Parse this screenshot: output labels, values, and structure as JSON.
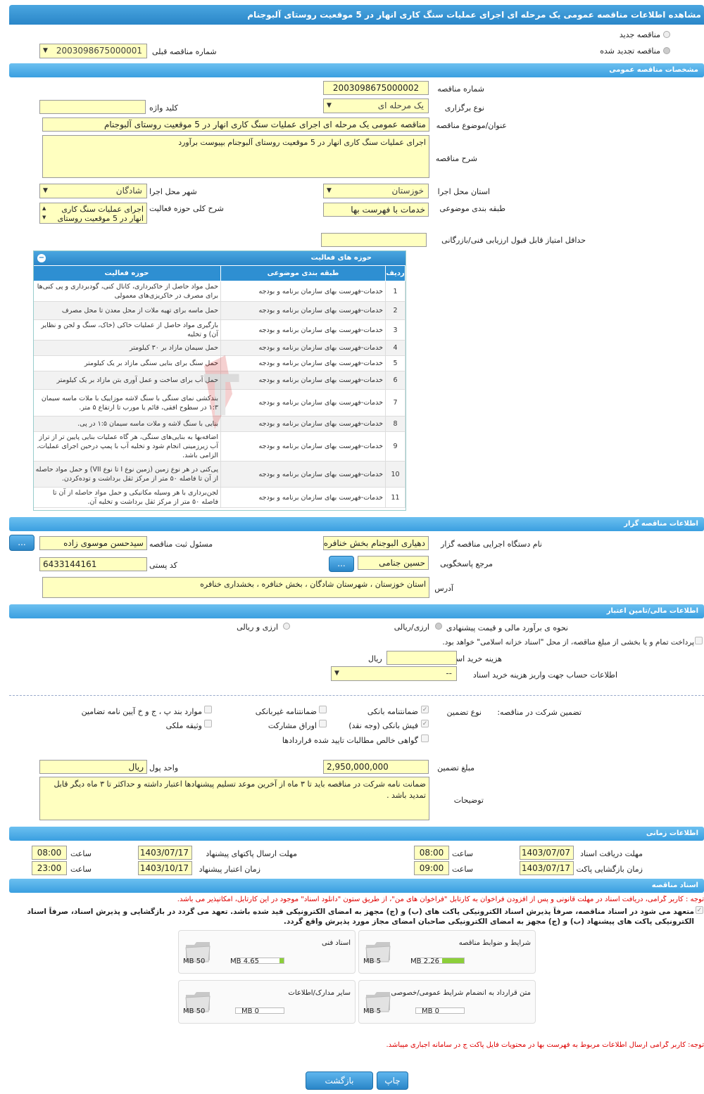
{
  "title": "مشاهده اطلاعات مناقصه عمومی یک مرحله ای اجرای عملیات سنگ کاری انهار در 5 موقعیت روستای آلبوجنام",
  "top": {
    "new_tender": "مناقصه جدید",
    "renewed_tender": "مناقصه تجدید شده",
    "prev_number_label": "شماره مناقصه قبلی",
    "prev_number": "2003098675000001"
  },
  "general": {
    "header": "مشخصات مناقصه عمومی",
    "number_label": "شماره مناقصه",
    "number": "2003098675000002",
    "type_label": "نوع برگزاری",
    "type": "یک مرحله ای",
    "keyword_label": "کلید واژه",
    "keyword": "",
    "subject_label": "عنوان/موضوع مناقصه",
    "subject": "مناقصه عمومی یک مرحله ای اجرای عملیات سنگ کاری انهار در 5 موقعیت روستای آلبوجنام",
    "desc_label": "شرح مناقصه",
    "desc": "اجرای عملیات سنگ کاری انهار در 5 موقعیت روستای آلبوجنام بپیوست برآورد",
    "province_label": "استان محل اجرا",
    "province": "خوزستان",
    "city_label": "شهر محل اجرا",
    "city": "شادگان",
    "category_label": "طبقه بندی موضوعی",
    "category": "خدمات با فهرست بها",
    "activity_label": "شرح کلی حوزه فعالیت",
    "activity": "اجرای عملیات سنگ کاری انهار در 5 موقعیت روستای",
    "min_score_label": "حداقل امتیاز قابل قبول ارزیابی فنی/بازرگانی",
    "min_score": ""
  },
  "activities": {
    "header": "حوزه های فعالیت",
    "col_row": "ردیف",
    "col_cat": "طبقه بندی موضوعی",
    "col_field": "حوزه فعالیت",
    "rows": [
      {
        "n": "1",
        "cat": "خدمات-فهرست بهای سازمان برنامه و بودجه",
        "field": "حمل مواد حاصل از خاکبرداری، کانال کنی، گودبرداری و پی کنی‌ها برای مصرف در خاکریزی‌های معمولی"
      },
      {
        "n": "2",
        "cat": "خدمات-فهرست بهای سازمان برنامه و بودجه",
        "field": "حمل ماسه برای تهیه ملات از محل معدن تا محل مصرف"
      },
      {
        "n": "3",
        "cat": "خدمات-فهرست بهای سازمان برنامه و بودجه",
        "field": "بارگیری مواد حاصل از عملیات خاکی (خاک، سنگ و لجن و نظایر آن) و تخلیه"
      },
      {
        "n": "4",
        "cat": "خدمات-فهرست بهای سازمان برنامه و بودجه",
        "field": "حمل سیمان مازاد بر ۳۰ کیلومتر"
      },
      {
        "n": "5",
        "cat": "خدمات-فهرست بهای سازمان برنامه و بودجه",
        "field": "حمل سنگ برای بنایی سنگی مازاد بر یک کیلومتر"
      },
      {
        "n": "6",
        "cat": "خدمات-فهرست بهای سازمان برنامه و بودجه",
        "field": "حمل آب برای ساخت و عمل آوری بتن مازاد بر یک کیلومتر"
      },
      {
        "n": "7",
        "cat": "خدمات-فهرست بهای سازمان برنامه و بودجه",
        "field": "بندکشی نمای سنگی با سنگ لاشه موزاییک با ملات ماسه سیمان ۱:۳ در سطوح افقی، قائم یا مورب تا ارتفاع ۵ متر."
      },
      {
        "n": "8",
        "cat": "خدمات-فهرست بهای سازمان برنامه و بودجه",
        "field": "بنایی با سنگ لاشه و ملات ماسه سیمان ۱:۵ در پی."
      },
      {
        "n": "9",
        "cat": "خدمات-فهرست بهای سازمان برنامه و بودجه",
        "field": "اضافه‌بها به بنایی‌های سنگی، هر گاه عملیات بنایی پایین تر از تراز آب زیرزمینی انجام شود و تخلیه آب با پمپ درحین اجرای عملیات، الزامی باشد."
      },
      {
        "n": "10",
        "cat": "خدمات-فهرست بهای سازمان برنامه و بودجه",
        "field": "پی‌کنی در هر نوع زمین (زمین نوع I تا نوع VII) و حمل مواد حاصله از آن تا فاصله ۵۰ متر از مرکز ثقل برداشت و توده‌کردن."
      },
      {
        "n": "11",
        "cat": "خدمات-فهرست بهای سازمان برنامه و بودجه",
        "field": "لجن‌برداری با هر وسیله مکانیکی و حمل مواد حاصله از آن تا فاصله ۵۰ متر از مرکز ثقل برداشت و تخلیه آن."
      }
    ]
  },
  "organizer": {
    "header": "اطلاعات مناقصه گزار",
    "org_label": "نام دستگاه اجرایی مناقصه گزار",
    "org": "دهیاری البوجنام بخش خنافره",
    "reg_label": "مسئول ثبت مناقصه",
    "reg": "سیدحسن موسوی زاده",
    "ref_label": "مرجع پاسخگویی",
    "ref": "حسین جنامی",
    "postal_label": "کد پستی",
    "postal": "6433144161",
    "addr_label": "آدرس",
    "addr": "استان خوزستان ، شهرستان شادگان ، بخش خنافره ، بخشداری خنافره",
    "dots": "..."
  },
  "finance": {
    "header": "اطلاعات مالی/تامین اعتبار",
    "est_label": "نحوه ی برآورد مالی و قیمت پیشنهادی",
    "opt1": "ارزی/ریالی",
    "opt2": "ارزی و ریالی",
    "treasury": "پرداخت تمام و یا بخشی از مبلغ مناقصه، از محل \"اسناد خزانه اسلامی\" خواهد بود.",
    "doc_fee_label": "هزینه خرید اسناد",
    "doc_fee": "",
    "currency": "ریال",
    "account_label": "اطلاعات حساب جهت واریز هزینه خرید اسناد",
    "account": "--"
  },
  "guarantee": {
    "part_label": "تضمین شرکت در مناقصه:",
    "type_label": "نوع تضمین",
    "items": [
      "ضمانتنامه بانکی",
      "ضمانتنامه غیربانکی",
      "موارد بند پ ، ج و خ آیین نامه تضامین",
      "فیش بانکی (وجه نقد)",
      "اوراق مشارکت",
      "وثیقه ملکی",
      "گواهی خالص مطالبات تایید شده قراردادها"
    ],
    "amount_label": "مبلغ تضمین",
    "amount": "2,950,000,000",
    "unit_label": "واحد پول",
    "unit": "ریال",
    "notes_label": "توضیحات",
    "notes": "ضمانت نامه شرکت در مناقصه باید تا ۳ ماه از آخرین موعد تسلیم پیشنهادها اعتبار داشته و حداکثر تا ۳ ماه دیگر قابل تمدید باشد ."
  },
  "timing": {
    "header": "اطلاعات زمانی",
    "receive_label": "مهلت دریافت اسناد",
    "receive_date": "1403/07/07",
    "receive_time": "08:00",
    "send_label": "مهلت ارسال پاکتهای پیشنهاد",
    "send_date": "1403/07/17",
    "send_time": "08:00",
    "open_label": "زمان بازگشایی پاکت ها",
    "open_date": "1403/07/17",
    "open_time": "09:00",
    "valid_label": "زمان اعتبار پیشنهاد",
    "valid_date": "1403/10/17",
    "valid_time": "23:00",
    "time_label": "ساعت"
  },
  "docs": {
    "header": "اسناد مناقصه",
    "note1": "توجه : کاربر گرامی، دریافت اسناد در مهلت قانونی و پس از افزودن فراخوان به کارتابل \"فراخوان های من\"، از طریق ستون \"دانلود اسناد\" موجود در این کارتابل، امکانپذیر می باشد.",
    "note2": "متعهد می شود در اسناد مناقصه، صرفاً پذیرش اسناد الکترونیکی پاکت های (ب) و (ج) مجهز به امضای الکترونیکی قید شده باشد. تعهد می گردد در بازگشایی و پذیرش اسناد، صرفاً اسناد الکترونیکی پاکت های پیشنهاد (ب) و (ج) مجهز به امضای الکترونیکی صاحبان امضای مجاز مورد پذیرش واقع گردد.",
    "files": [
      {
        "name": "شرایط و ضوابط مناقصه",
        "size": "2.26 MB",
        "max": "5 MB",
        "fill": 0.45
      },
      {
        "name": "اسناد فنی",
        "size": "4.65 MB",
        "max": "50 MB",
        "fill": 0.09
      },
      {
        "name": "متن قرارداد به انضمام شرایط عمومی/خصوصی",
        "size": "0 MB",
        "max": "5 MB",
        "fill": 0
      },
      {
        "name": "سایر مدارک/اطلاعات",
        "size": "0 MB",
        "max": "50 MB",
        "fill": 0
      }
    ],
    "note3": "توجه: کاربر گرامی ارسال اطلاعات مربوط به فهرست بها در محتویات فایل پاکت ج در سامانه اجباری میباشد."
  },
  "buttons": {
    "print": "چاپ",
    "back": "بازگشت"
  },
  "watermark": "AriaTender.neT"
}
